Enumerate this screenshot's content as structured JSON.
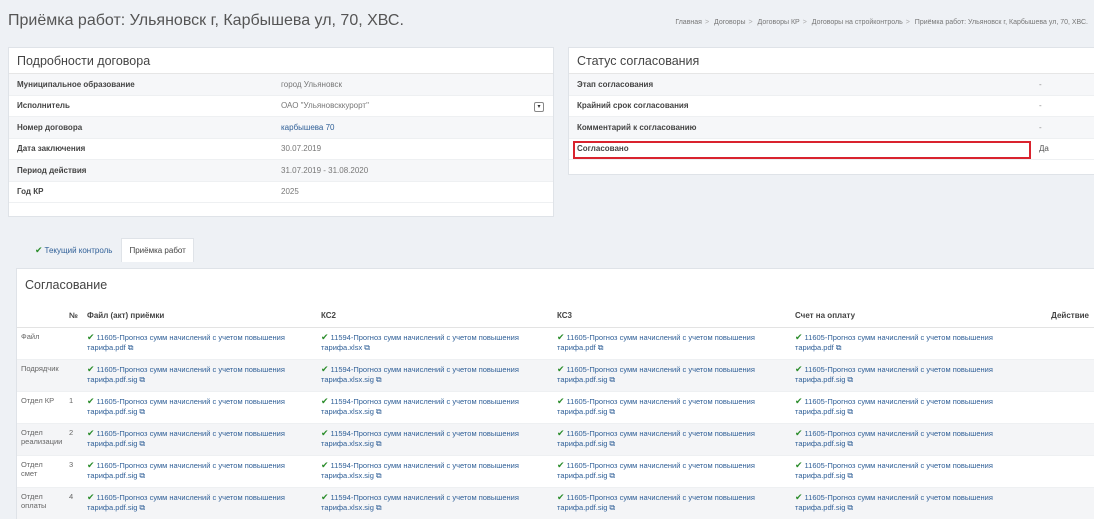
{
  "page_title": "Приёмка работ: Ульяновск г, Карбышева ул, 70, ХВС.",
  "breadcrumbs": [
    "Главная",
    "Договоры",
    "Договоры КР",
    "Договоры на стройконтроль",
    "Приёмка работ: Ульяновск г, Карбышева ул, 70, ХВС."
  ],
  "contract": {
    "title": "Подробности договора",
    "rows": [
      {
        "label": "Муниципальное образование",
        "value": "город Ульяновск"
      },
      {
        "label": "Исполнитель",
        "value": "ОАО \"Ульяновсккурорт\""
      },
      {
        "label": "Номер договора",
        "value": "карбышева 70"
      },
      {
        "label": "Дата заключения",
        "value": "30.07.2019"
      },
      {
        "label": "Период действия",
        "value": "31.07.2019 - 31.08.2020"
      },
      {
        "label": "Год КР",
        "value": "2025"
      }
    ]
  },
  "status": {
    "title": "Статус согласования",
    "rows": [
      {
        "label": "Этап согласования",
        "value": "-"
      },
      {
        "label": "Крайний срок согласования",
        "value": "-"
      },
      {
        "label": "Комментарий к согласованию",
        "value": "-"
      },
      {
        "label": "Согласовано",
        "value": "Да"
      }
    ]
  },
  "tabs": [
    {
      "label": "Текущий контроль"
    },
    {
      "label": "Приёмка работ"
    }
  ],
  "approval": {
    "title": "Согласование",
    "columns": [
      "№",
      "Файл (акт) приёмки",
      "КС2",
      "КС3",
      "Счет на оплату",
      "Действие"
    ],
    "rows": [
      {
        "role": "Файл",
        "num": "",
        "act": "11605-Прогноз сумм начислений с учетом повышения тарифа.pdf",
        "ks2": "11594-Прогноз сумм начислений с учетом повышения тарифа.xlsx",
        "ks3": "11605-Прогноз сумм начислений с учетом повышения тарифа.pdf",
        "invoice": "11605-Прогноз сумм начислений с учетом повышения тарифа.pdf"
      },
      {
        "role": "Подрядчик",
        "num": "",
        "act": "11605-Прогноз сумм начислений с учетом повышения тарифа.pdf.sig",
        "ks2": "11594-Прогноз сумм начислений с учетом повышения тарифа.xlsx.sig",
        "ks3": "11605-Прогноз сумм начислений с учетом повышения тарифа.pdf.sig",
        "invoice": "11605-Прогноз сумм начислений с учетом повышения тарифа.pdf.sig"
      },
      {
        "role": "Отдел КР",
        "num": "1",
        "act": "11605-Прогноз сумм начислений с учетом повышения тарифа.pdf.sig",
        "ks2": "11594-Прогноз сумм начислений с учетом повышения тарифа.xlsx.sig",
        "ks3": "11605-Прогноз сумм начислений с учетом повышения тарифа.pdf.sig",
        "invoice": "11605-Прогноз сумм начислений с учетом повышения тарифа.pdf.sig"
      },
      {
        "role": "Отдел реализации",
        "num": "2",
        "act": "11605-Прогноз сумм начислений с учетом повышения тарифа.pdf.sig",
        "ks2": "11594-Прогноз сумм начислений с учетом повышения тарифа.xlsx.sig",
        "ks3": "11605-Прогноз сумм начислений с учетом повышения тарифа.pdf.sig",
        "invoice": "11605-Прогноз сумм начислений с учетом повышения тарифа.pdf.sig"
      },
      {
        "role": "Отдел смет",
        "num": "3",
        "act": "11605-Прогноз сумм начислений с учетом повышения тарифа.pdf.sig",
        "ks2": "11594-Прогноз сумм начислений с учетом повышения тарифа.xlsx.sig",
        "ks3": "11605-Прогноз сумм начислений с учетом повышения тарифа.pdf.sig",
        "invoice": "11605-Прогноз сумм начислений с учетом повышения тарифа.pdf.sig"
      },
      {
        "role": "Отдел оплаты",
        "num": "4",
        "act": "11605-Прогноз сумм начислений с учетом повышения тарифа.pdf.sig",
        "ks2": "11594-Прогноз сумм начислений с учетом повышения тарифа.xlsx.sig",
        "ks3": "11605-Прогноз сумм начислений с учетом повышения тарифа.pdf.sig",
        "invoice": "11605-Прогноз сумм начислений с учетом повышения тарифа.pdf.sig"
      }
    ]
  },
  "colors": {
    "link": "#2f5f97",
    "check": "#2a8c2a",
    "highlight": "#d9232e"
  },
  "icons": {
    "check": "check-icon",
    "external": "external-link-icon",
    "dropdown": "chevron-down-icon"
  }
}
